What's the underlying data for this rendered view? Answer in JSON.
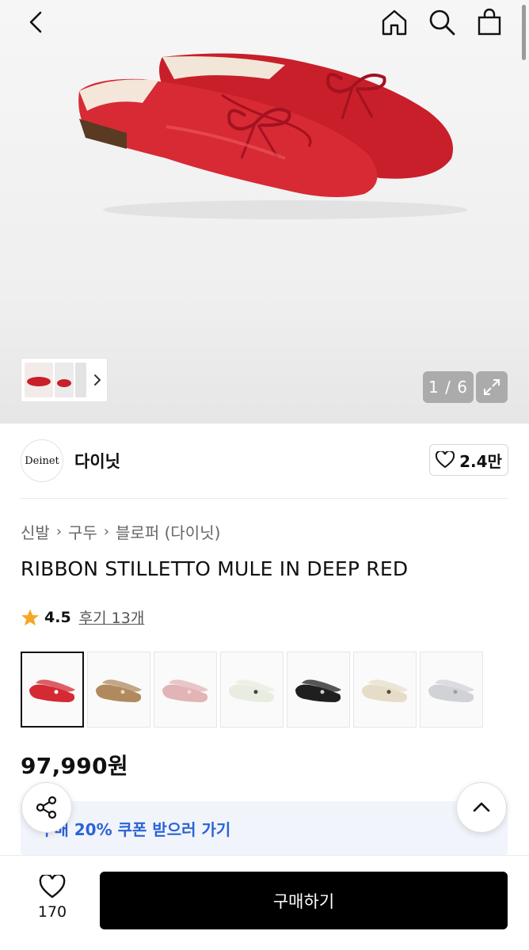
{
  "header": {
    "icons": [
      "back-icon",
      "home-icon",
      "search-icon",
      "shopping-bag-icon"
    ]
  },
  "gallery": {
    "counter": "1 / 6"
  },
  "brand": {
    "logo_text": "Deinet",
    "name": "다이닛",
    "likes": "2.4만"
  },
  "breadcrumb": {
    "items": [
      "신발",
      "구두",
      "블로퍼 (다이닛)"
    ]
  },
  "product": {
    "title": "RIBBON STILLETTO MULE IN DEEP RED",
    "rating": "4.5",
    "reviews": "후기 13개",
    "price": "97,990원"
  },
  "swatches": [
    {
      "color": "#d32a34",
      "accent": "#ffffff"
    },
    {
      "color": "#b08a5e",
      "accent": "#e8d7bd"
    },
    {
      "color": "#e2b4b6",
      "accent": "#f4dada"
    },
    {
      "color": "#e9ece1",
      "accent": "#444444"
    },
    {
      "color": "#1f1f1f",
      "accent": "#cfcfcf"
    },
    {
      "color": "#e6ddc8",
      "accent": "#5a4a33"
    },
    {
      "color": "#d0d2d6",
      "accent": "#9aa0a8"
    }
  ],
  "coupon": {
    "text": "구매 20% 쿠폰 받으러 가기"
  },
  "bottom": {
    "wish_count": "170",
    "buy_label": "구매하기"
  },
  "colors": {
    "accent_blue": "#2a63d6",
    "shoe_red": "#d32a34",
    "star": "#f5a623"
  }
}
